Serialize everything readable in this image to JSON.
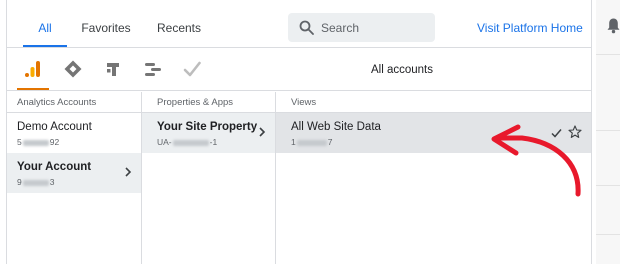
{
  "tabs": [
    {
      "label": "All",
      "active": true
    },
    {
      "label": "Favorites",
      "active": false
    },
    {
      "label": "Recents",
      "active": false
    }
  ],
  "search": {
    "placeholder": "Search"
  },
  "platform_link": "Visit Platform Home",
  "product_icons": [
    "analytics-icon",
    "tag-manager-icon",
    "optimize-icon",
    "data-studio-icon",
    "surveys-icon"
  ],
  "row_title": "All accounts",
  "columns": {
    "accounts": {
      "header": "Analytics Accounts",
      "items": [
        {
          "name": "Demo Account",
          "id_prefix": "5",
          "id_suffix": "92",
          "selected": false
        },
        {
          "name": "Your Account",
          "id_prefix": "9",
          "id_suffix": "3",
          "selected": true
        }
      ]
    },
    "properties": {
      "header": "Properties & Apps",
      "items": [
        {
          "name": "Your Site Property",
          "id_prefix": "UA-",
          "id_suffix": "-1",
          "selected": true
        }
      ]
    },
    "views": {
      "header": "Views",
      "items": [
        {
          "name": "All Web Site Data",
          "id_prefix": "1",
          "id_suffix": "7",
          "selected": true
        }
      ]
    }
  },
  "colors": {
    "accent": "#1a73e8",
    "analytics_orange": "#e37400",
    "annotation_red": "#e8192c"
  }
}
